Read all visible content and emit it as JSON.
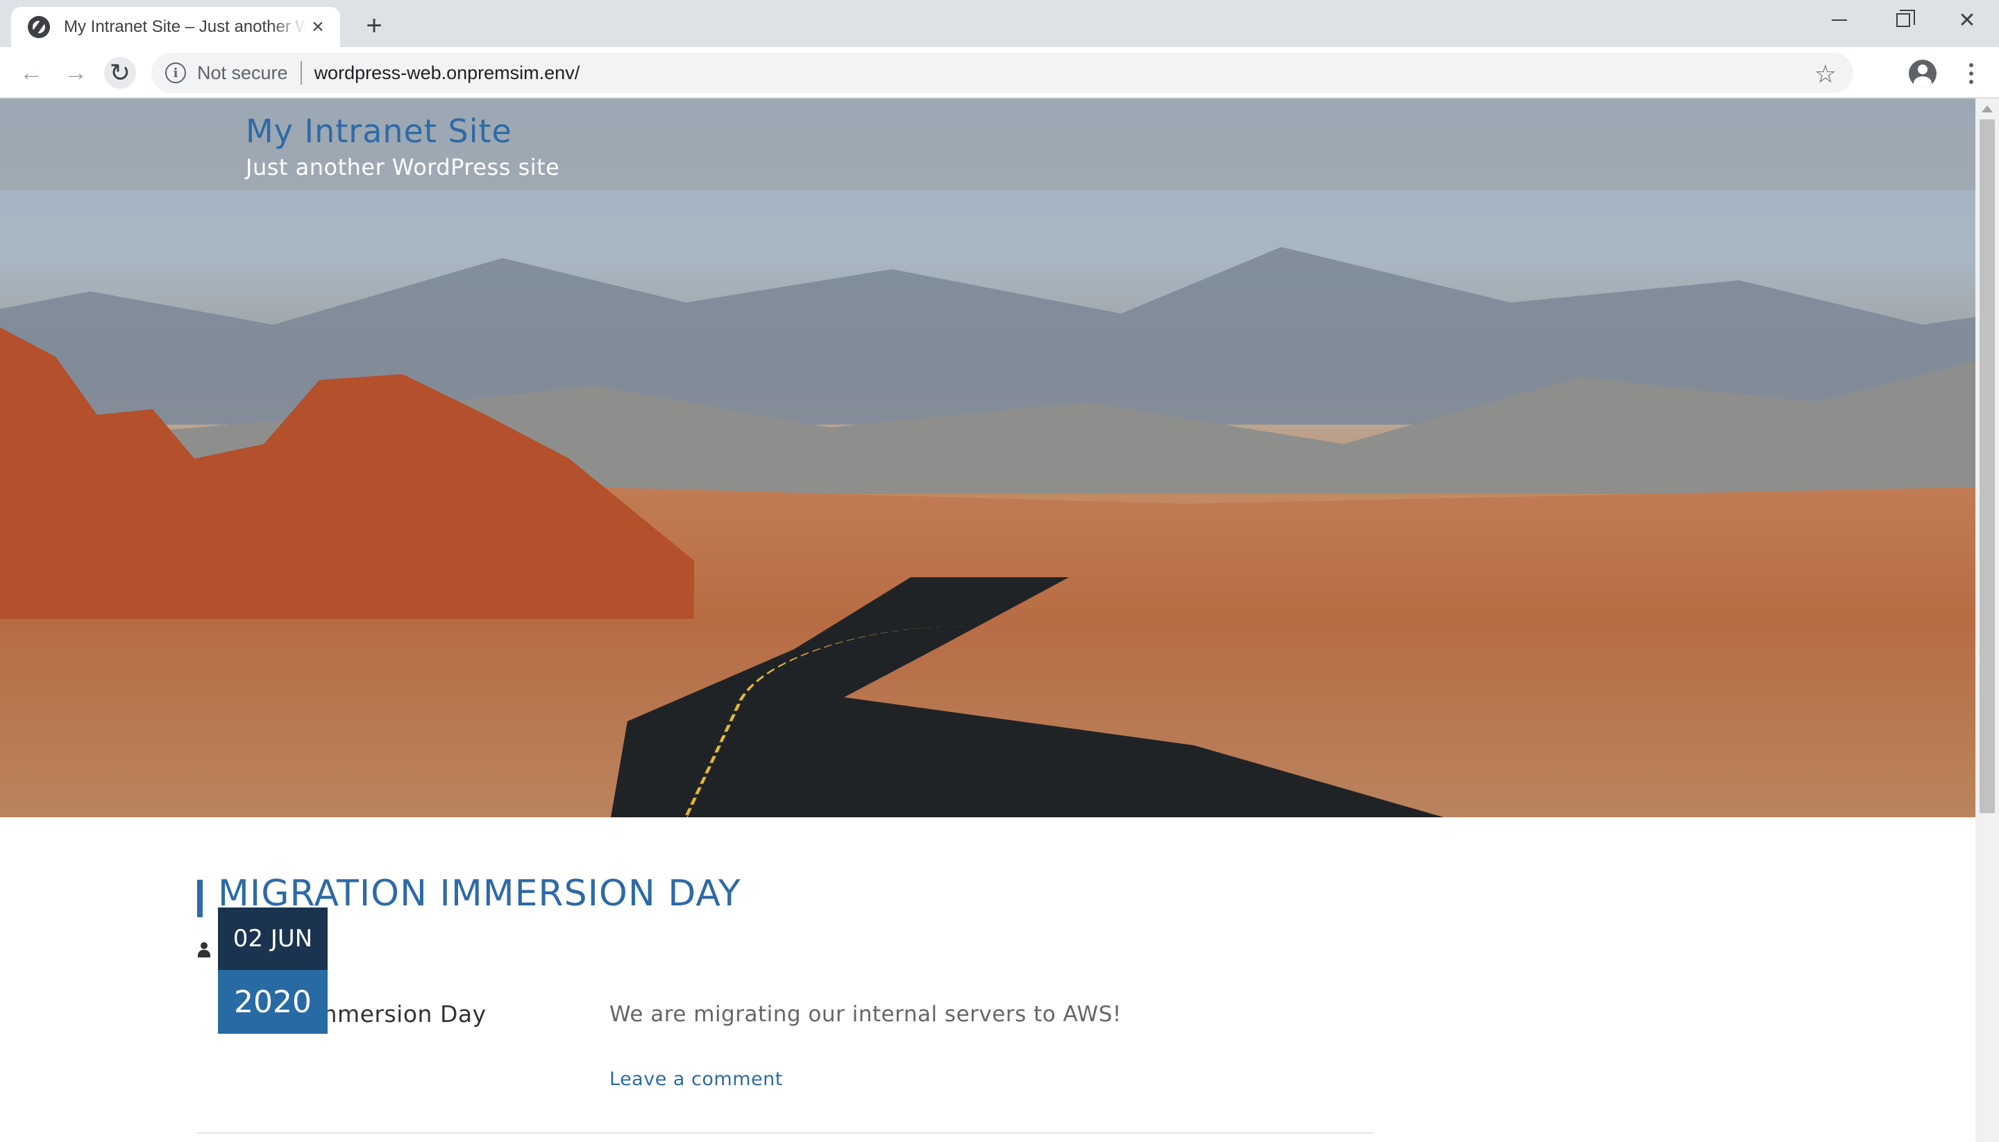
{
  "browser": {
    "tab_title": "My Intranet Site – Just another WordPress site",
    "new_tab": "+",
    "security_label": "Not secure",
    "url": "wordpress-web.onpremsim.env/",
    "icons": [
      "globe-icon",
      "close-icon",
      "back-icon",
      "forward-icon",
      "reload-icon",
      "info-icon",
      "star-icon",
      "account-icon",
      "menu-icon"
    ]
  },
  "window": {
    "close_glyph": "✕"
  },
  "site": {
    "title": "My Intranet Site",
    "description": "Just another WordPress site"
  },
  "post": {
    "title": "MIGRATION IMMERSION DAY",
    "meta_comment": "Leave a comment",
    "meta_comment_visible": "ment",
    "category_visible": "on Immersion Day",
    "excerpt": "We are migrating our internal servers to AWS!",
    "leave_comment": "Leave a comment",
    "date_day": "02 JUN",
    "date_year": "2020"
  },
  "colors": {
    "accent": "#2e6aa6",
    "date_dark": "#1a3450",
    "date_blue": "#276aa4"
  }
}
